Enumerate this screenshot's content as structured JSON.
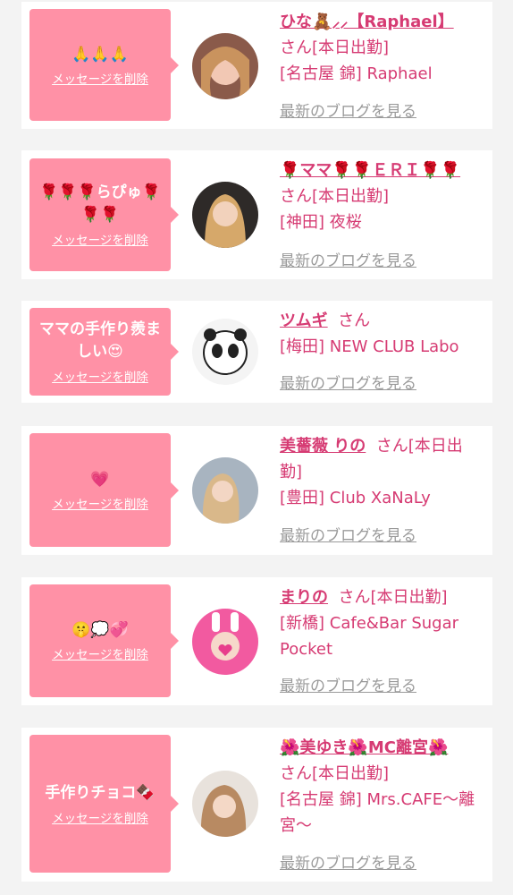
{
  "colors": {
    "accent": "#d63b73",
    "bubble": "#ff91a6",
    "link_gray": "#9a9a9a",
    "bg": "#f3f3f3"
  },
  "common": {
    "delete_label": "メッセージを削除",
    "blog_label": "最新のブログを見る"
  },
  "cards": [
    {
      "bubble_text": "🙏🙏🙏",
      "name": "ひな🧸⸝⸝【Raphael】",
      "suffix": "さん[本日出勤]",
      "location": "[名古屋 錦] Raphael"
    },
    {
      "bubble_text": "🌹🌹🌹らぴゅ🌹🌹🌹",
      "name": "🌹ママ🌹🌹ＥＲＩ🌹🌹",
      "suffix": "さん[本日出勤]",
      "location": "[神田] 夜桜"
    },
    {
      "bubble_text": "ママの手作り羨ましい😍",
      "name": "ツムギ",
      "suffix": "さん",
      "location": "[梅田] NEW CLUB Labo"
    },
    {
      "bubble_text": "💗",
      "name": "美薔薇 りの",
      "suffix": "さん[本日出勤]",
      "location": "[豊田] Club XaNaLy"
    },
    {
      "bubble_text": "🤫💭💞",
      "name": "まりの",
      "suffix": "さん[本日出勤]",
      "location": "[新橋] Cafe&Bar Sugar Pocket"
    },
    {
      "bubble_text": "手作りチョコ🍫",
      "name": "🌺美ゆき🌺MC離宮🌺",
      "suffix": "さん[本日出勤]",
      "location": "[名古屋 錦] Mrs.CAFE～離宮～"
    }
  ]
}
